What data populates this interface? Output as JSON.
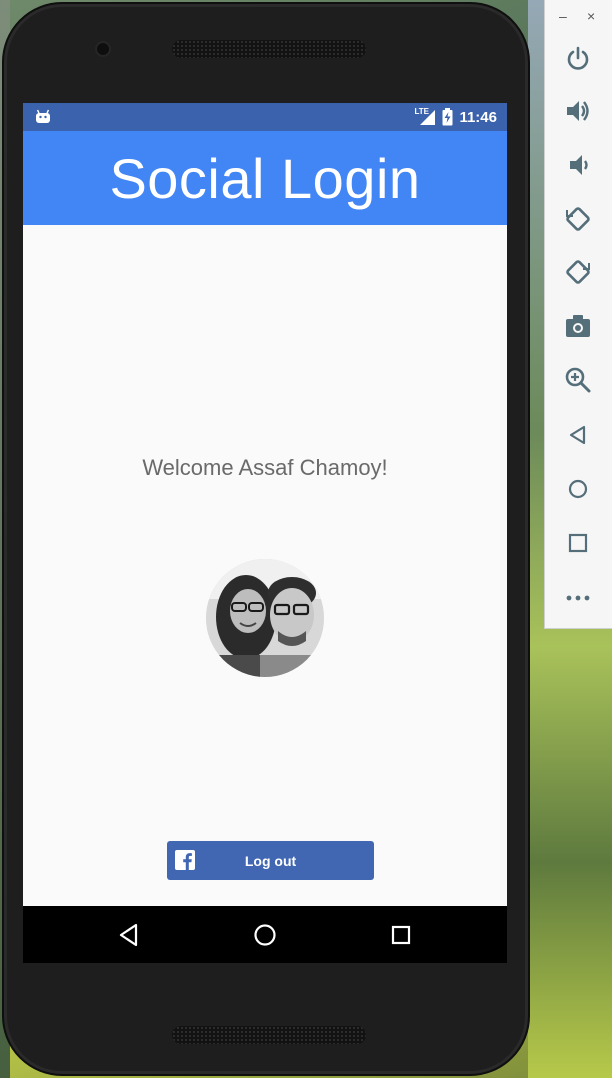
{
  "status_bar": {
    "network": "LTE",
    "time": "11:46"
  },
  "app_bar": {
    "title": "Social Login"
  },
  "main": {
    "welcome_text": "Welcome Assaf Chamoy!"
  },
  "facebook_button": {
    "label": "Log out"
  },
  "nav_bar": {
    "icons": [
      "back-icon",
      "home-icon",
      "recents-icon"
    ]
  },
  "emulator_toolbar": {
    "window_controls": [
      "–",
      "×"
    ],
    "icons": [
      "power-icon",
      "volume-up-icon",
      "volume-down-icon",
      "rotate-left-icon",
      "rotate-right-icon",
      "camera-icon",
      "zoom-icon",
      "back-icon",
      "home-icon",
      "overview-icon",
      "more-icon"
    ]
  },
  "colors": {
    "status_bar": "#3a62ad",
    "app_bar": "#4285f4",
    "facebook_blue": "#4267b2",
    "screen_background": "#fafafa"
  }
}
